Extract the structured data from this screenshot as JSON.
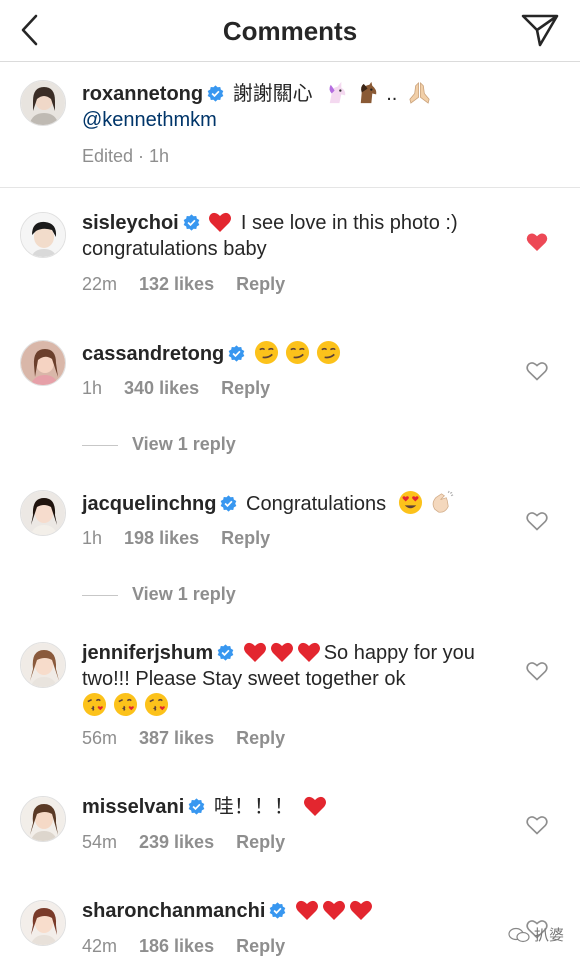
{
  "header": {
    "title": "Comments"
  },
  "caption": {
    "username": "roxannetong",
    "text": "謝謝關心",
    "emojis": [
      "unicorn",
      "horse",
      "ellipsis",
      "praying-hands"
    ],
    "ellipsis": "..",
    "mention": "@kennethmkm",
    "meta": "Edited · 1h"
  },
  "comments": [
    {
      "username": "sisleychoi",
      "text": "I see love in this photo :) congratulations baby",
      "time": "22m",
      "likes": "132 likes",
      "reply": "Reply",
      "liked": true
    },
    {
      "username": "cassandretong",
      "text": "",
      "time": "1h",
      "likes": "340 likes",
      "reply": "Reply",
      "view_replies": "View 1 reply",
      "liked": false
    },
    {
      "username": "jacquelinchng",
      "text": "Congratulations",
      "time": "1h",
      "likes": "198 likes",
      "reply": "Reply",
      "view_replies": "View 1 reply",
      "liked": false
    },
    {
      "username": "jenniferjshum",
      "text": "So happy for you two!!! Please Stay sweet together ok",
      "time": "56m",
      "likes": "387 likes",
      "reply": "Reply",
      "liked": false
    },
    {
      "username": "misselvani",
      "text": "哇！！！",
      "time": "54m",
      "likes": "239 likes",
      "reply": "Reply",
      "liked": false
    },
    {
      "username": "sharonchanmanchi",
      "text": "",
      "time": "42m",
      "likes": "186 likes",
      "reply": "Reply",
      "liked": false
    }
  ],
  "watermark": {
    "text": "扒婆"
  },
  "colors": {
    "heart_red": "#ed4956",
    "verified_blue": "#3897f0",
    "meta_gray": "#8e8e8e",
    "mention_blue": "#003569"
  }
}
